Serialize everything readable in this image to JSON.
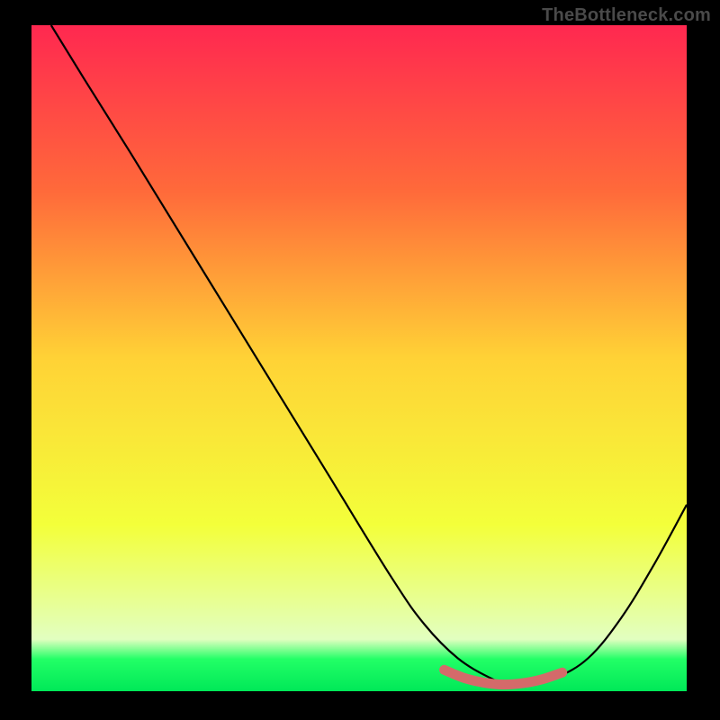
{
  "watermark": "TheBottleneck.com",
  "chart_data": {
    "type": "line",
    "title": "",
    "xlabel": "",
    "ylabel": "",
    "xlim": [
      0,
      100
    ],
    "ylim": [
      0,
      100
    ],
    "grid": false,
    "legend": false,
    "background_gradient": {
      "stops": [
        {
          "pos": 0.0,
          "color": "#ff2850"
        },
        {
          "pos": 0.25,
          "color": "#ff6a3a"
        },
        {
          "pos": 0.5,
          "color": "#ffd236"
        },
        {
          "pos": 0.75,
          "color": "#f3ff3a"
        },
        {
          "pos": 0.922,
          "color": "#e2ffc0"
        },
        {
          "pos": 0.952,
          "color": "#22ff66"
        },
        {
          "pos": 1.0,
          "color": "#00e858"
        }
      ]
    },
    "series": [
      {
        "name": "bottleneck-curve",
        "color": "#000000",
        "x": [
          3,
          8,
          15,
          25,
          35,
          45,
          55,
          60,
          65,
          70,
          73,
          76,
          80,
          85,
          90,
          95,
          100
        ],
        "y": [
          100,
          92,
          81,
          65,
          49,
          33,
          17,
          10,
          5,
          2,
          1,
          1,
          2,
          5,
          11,
          19,
          28
        ]
      },
      {
        "name": "optimal-region",
        "color": "#d46a6a",
        "style": "thick-segment",
        "x": [
          63,
          66,
          69,
          72,
          75,
          78,
          81
        ],
        "y": [
          3.2,
          2.0,
          1.3,
          1.0,
          1.2,
          1.8,
          2.8
        ]
      }
    ]
  }
}
